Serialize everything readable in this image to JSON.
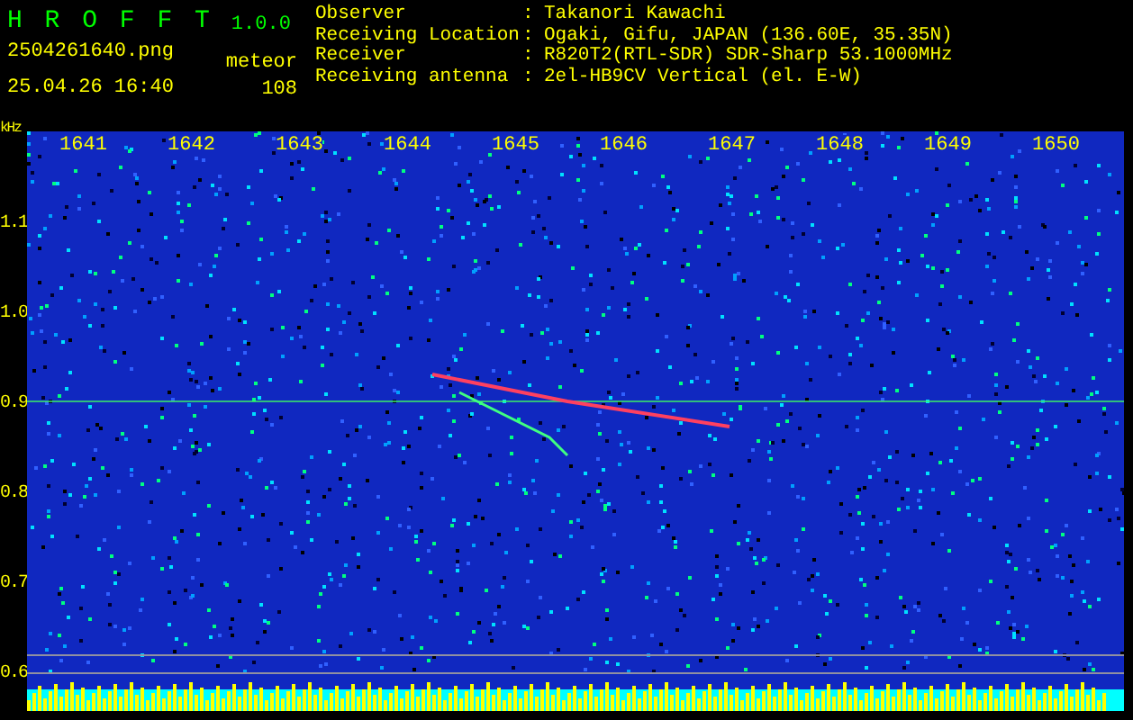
{
  "header": {
    "app_name": "H R O F F T",
    "version": "1.0.0",
    "filename": "2504261640.png",
    "datetime": "25.04.26 16:40",
    "mode_label": "meteor",
    "count": "108"
  },
  "station_info": [
    {
      "label": "Observer",
      "separator": ":",
      "value": "Takanori Kawachi"
    },
    {
      "label": "Receiving Location",
      "separator": ":",
      "value": "Ogaki, Gifu, JAPAN (136.60E, 35.35N)"
    },
    {
      "label": "Receiver",
      "separator": ":",
      "value": "R820T2(RTL-SDR) SDR-Sharp 53.1000MHz"
    },
    {
      "label": "Receiving antenna",
      "separator": ":",
      "value": "2el-HB9CV Vertical (el. E-W)"
    }
  ],
  "spectrogram": {
    "y_unit": "kHz",
    "x_labels": [
      "1641",
      "1642",
      "1643",
      "1644",
      "1645",
      "1646",
      "1647",
      "1648",
      "1649",
      "1650"
    ],
    "y_labels": [
      "1.1",
      "1.0",
      "0.9",
      "0.8",
      "0.7",
      "0.6"
    ]
  }
}
